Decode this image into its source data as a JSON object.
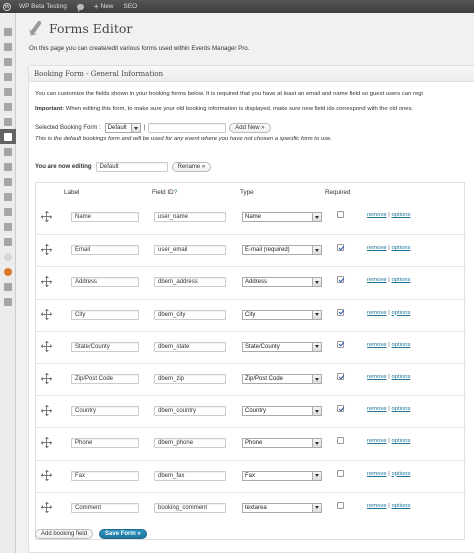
{
  "admin_bar": {
    "site_name": "WP Beta Testing",
    "new_label": "New",
    "seo_label": "SEO"
  },
  "page": {
    "title": "Forms Editor",
    "intro": "On this page you can create/edit various forms used within Events Manager Pro."
  },
  "box": {
    "title": "Booking Form - General Information",
    "desc": "You can customize the fields shown in your booking forms below. It is required that you have at least an email and name field so guest users can regi",
    "important_label": "Important:",
    "important_text": " When editing this form, to make sure your old booking information is displayed, make sure new field ids correspond with the old ones.",
    "selected_label": "Selected Booking Form :",
    "selected_value": "Default",
    "new_name_value": "",
    "add_new_label": "Add New »",
    "default_note": "This is the default bookings form and will be used for any event where you have not chosen a specific form to use.",
    "editing_label": "You are now editing",
    "editing_value": "Default",
    "rename_label": "Rename »"
  },
  "table": {
    "headers": {
      "label": "Label",
      "field_id": "Field ID",
      "field_id_help": "?",
      "type": "Type",
      "required": "Required"
    },
    "remove_label": "remove",
    "separator": " | ",
    "options_label": "options",
    "rows": [
      {
        "label": "Name",
        "id": "user_name",
        "type": "Name",
        "required": false
      },
      {
        "label": "Email",
        "id": "user_email",
        "type": "E-mail (required)",
        "required": true
      },
      {
        "label": "Address",
        "id": "dbem_address",
        "type": "Address",
        "required": true
      },
      {
        "label": "City",
        "id": "dbem_city",
        "type": "City",
        "required": true
      },
      {
        "label": "State/County",
        "id": "dbem_state",
        "type": "State/County",
        "required": true
      },
      {
        "label": "Zip/Post Code",
        "id": "dbem_zip",
        "type": "Zip/Post Code",
        "required": true
      },
      {
        "label": "Country",
        "id": "dbem_country",
        "type": "Country",
        "required": true
      },
      {
        "label": "Phone",
        "id": "dbem_phone",
        "type": "Phone",
        "required": false
      },
      {
        "label": "Fax",
        "id": "dbem_fax",
        "type": "Fax",
        "required": false
      },
      {
        "label": "Comment",
        "id": "booking_comment",
        "type": "textarea",
        "required": false
      }
    ]
  },
  "buttons": {
    "add_field": "Add booking field",
    "save_form": "Save Form »"
  },
  "colors": {
    "admin_bar": "#464646",
    "link": "#21759b",
    "primary_button": "#21759b"
  }
}
